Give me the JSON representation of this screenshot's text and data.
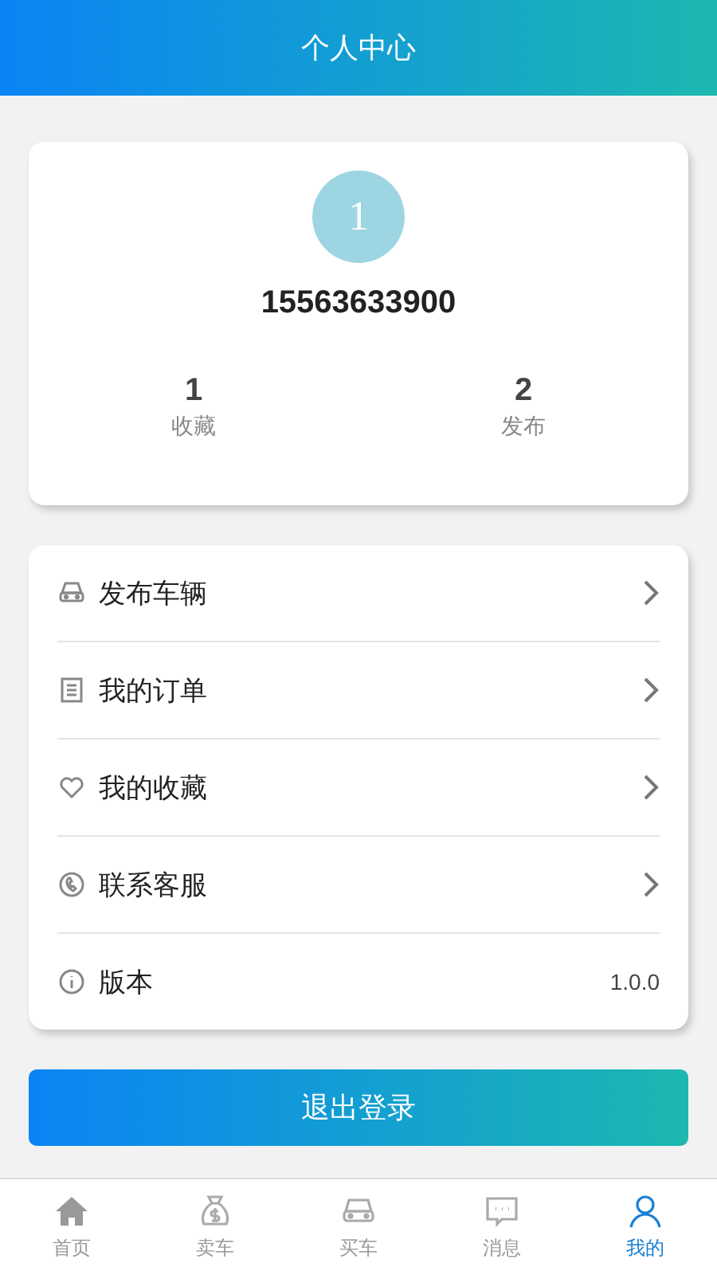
{
  "header": {
    "title": "个人中心"
  },
  "profile": {
    "avatar": "1",
    "phone": "15563633900",
    "stats": [
      {
        "value": "1",
        "label": "收藏"
      },
      {
        "value": "2",
        "label": "发布"
      }
    ]
  },
  "menu": [
    {
      "kind": "link",
      "label": "发布车辆"
    },
    {
      "kind": "link",
      "label": "我的订单"
    },
    {
      "kind": "link",
      "label": "我的收藏"
    },
    {
      "kind": "link",
      "label": "联系客服"
    },
    {
      "kind": "info",
      "label": "版本",
      "value": "1.0.0"
    }
  ],
  "logout_button": "退出登录",
  "tabs": [
    {
      "label": "首页",
      "selected": false
    },
    {
      "label": "卖车",
      "selected": false
    },
    {
      "label": "买车",
      "selected": false
    },
    {
      "label": "消息",
      "selected": false
    },
    {
      "label": "我的",
      "selected": true
    }
  ]
}
